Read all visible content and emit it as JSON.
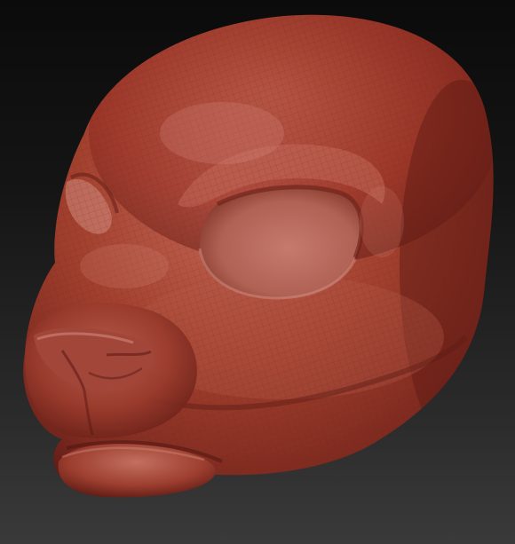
{
  "scene": {
    "subject_icon": "sculpted-animal-head-icon",
    "colors": {
      "background_top": "#0b0b0b",
      "background_bottom": "#3a3a3a",
      "clay_base": "#9c3a2c",
      "clay_highlight": "#c96b5c",
      "clay_shadow": "#4f1711",
      "wire": "#7a2a20"
    }
  }
}
